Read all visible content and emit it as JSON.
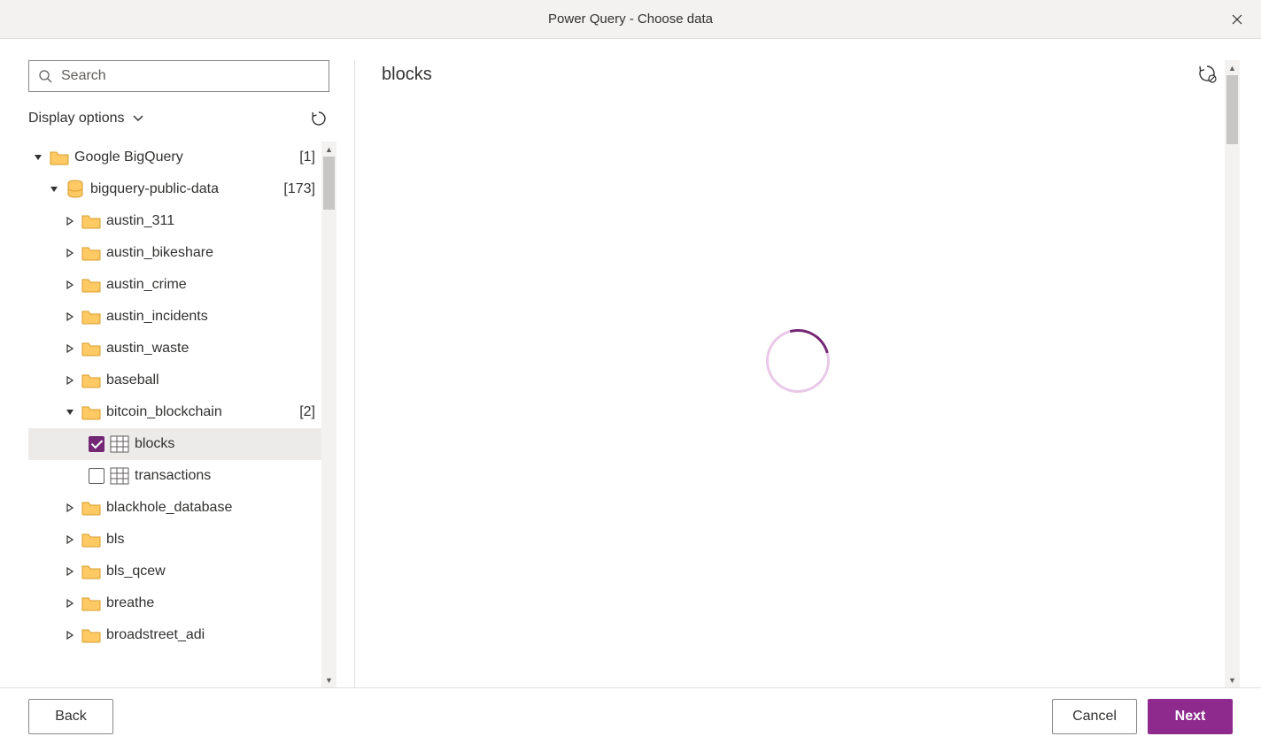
{
  "title": "Power Query - Choose data",
  "search": {
    "placeholder": "Search"
  },
  "displayOptions": {
    "label": "Display options"
  },
  "tree": {
    "root": {
      "label": "Google BigQuery",
      "count": "[1]"
    },
    "project": {
      "label": "bigquery-public-data",
      "count": "[173]"
    },
    "folders": [
      {
        "label": "austin_311"
      },
      {
        "label": "austin_bikeshare"
      },
      {
        "label": "austin_crime"
      },
      {
        "label": "austin_incidents"
      },
      {
        "label": "austin_waste"
      },
      {
        "label": "baseball"
      }
    ],
    "expandedFolder": {
      "label": "bitcoin_blockchain",
      "count": "[2]"
    },
    "tables": [
      {
        "label": "blocks",
        "checked": true,
        "selected": true
      },
      {
        "label": "transactions",
        "checked": false,
        "selected": false
      }
    ],
    "foldersAfter": [
      {
        "label": "blackhole_database"
      },
      {
        "label": "bls"
      },
      {
        "label": "bls_qcew"
      },
      {
        "label": "breathe"
      },
      {
        "label": "broadstreet_adi"
      }
    ]
  },
  "preview": {
    "title": "blocks"
  },
  "footer": {
    "back": "Back",
    "cancel": "Cancel",
    "next": "Next"
  }
}
